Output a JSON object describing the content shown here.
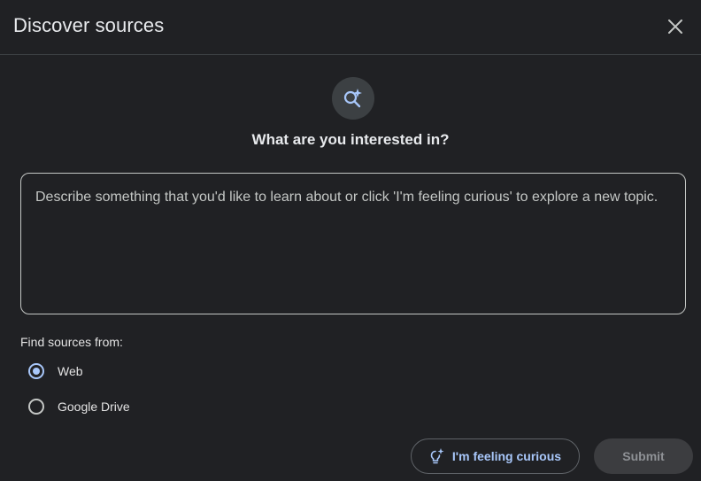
{
  "dialog": {
    "title": "Discover sources",
    "close_icon": "close-icon",
    "hero_icon": "sparkle-search-icon",
    "question": "What are you interested in?"
  },
  "prompt": {
    "value": "",
    "placeholder": "Describe something that you'd like to learn about or click 'I'm feeling curious' to explore a new topic."
  },
  "sources": {
    "label": "Find sources from:",
    "options": [
      {
        "label": "Web",
        "selected": true
      },
      {
        "label": "Google Drive",
        "selected": false
      }
    ]
  },
  "actions": {
    "curious_label": "I'm feeling curious",
    "curious_icon": "lightbulb-sparkle-icon",
    "submit_label": "Submit",
    "submit_enabled": false
  },
  "colors": {
    "background": "#202124",
    "accent": "#a8c7fa",
    "border": "#c4c7c5",
    "divider": "#3c4043"
  }
}
